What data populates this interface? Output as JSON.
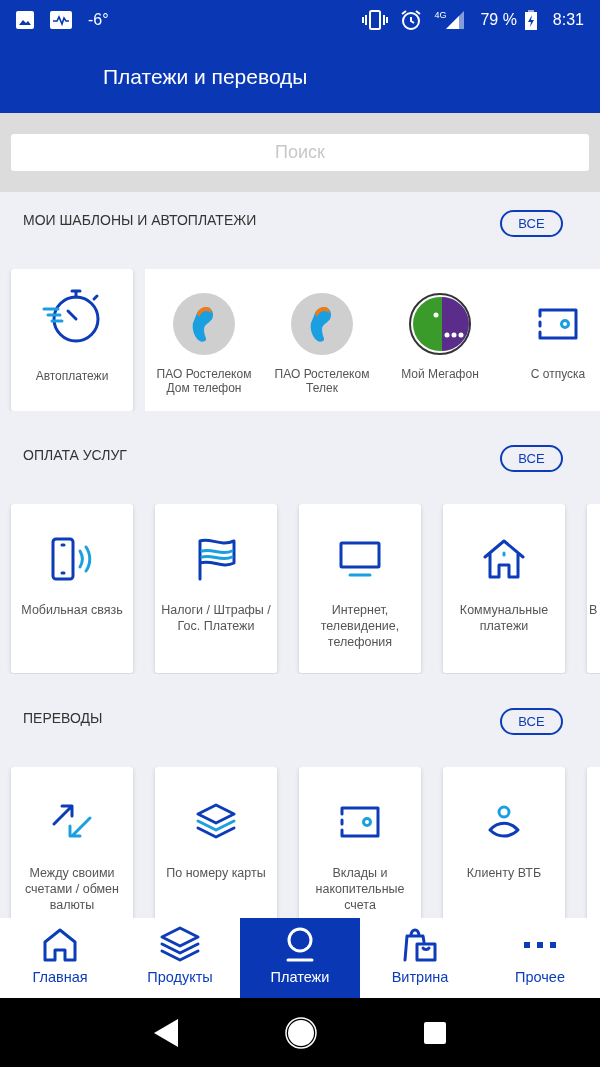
{
  "status_bar": {
    "temperature": "-6°",
    "network": "4G",
    "battery": "79 %",
    "time": "8:31"
  },
  "header": {
    "title": "Платежи и переводы"
  },
  "search": {
    "placeholder": "Поиск"
  },
  "sections": [
    {
      "title": "МОИ ШАБЛОНЫ И АВТОПЛАТЕЖИ",
      "button": "ВСЕ",
      "items": [
        {
          "label": "Автоплатежи"
        },
        {
          "label": "ПАО Ростелеком Дом телефон"
        },
        {
          "label": "ПАО Ростелеком Телек"
        },
        {
          "label": "Мой Мегафон"
        },
        {
          "label": "С отпуска"
        }
      ]
    },
    {
      "title": "ОПЛАТА УСЛУГ",
      "button": "ВСЕ",
      "items": [
        {
          "label": "Мобильная связь"
        },
        {
          "label": "Налоги / Штрафы / Гос. Платежи"
        },
        {
          "label": "Интернет, телевидение, телефония"
        },
        {
          "label": "Коммунальные платежи"
        },
        {
          "label": "В"
        }
      ]
    },
    {
      "title": "ПЕРЕВОДЫ",
      "button": "ВСЕ",
      "items": [
        {
          "label": "Между своими счетами / обмен валюты"
        },
        {
          "label": "По номеру карты"
        },
        {
          "label": "Вклады и накопительные счета"
        },
        {
          "label": "Клиенту ВТБ"
        }
      ]
    }
  ],
  "bottom_nav": [
    {
      "label": "Главная",
      "selected": false
    },
    {
      "label": "Продукты",
      "selected": false
    },
    {
      "label": "Платежи",
      "selected": true
    },
    {
      "label": "Витрина",
      "selected": false
    },
    {
      "label": "Прочее",
      "selected": false
    }
  ]
}
